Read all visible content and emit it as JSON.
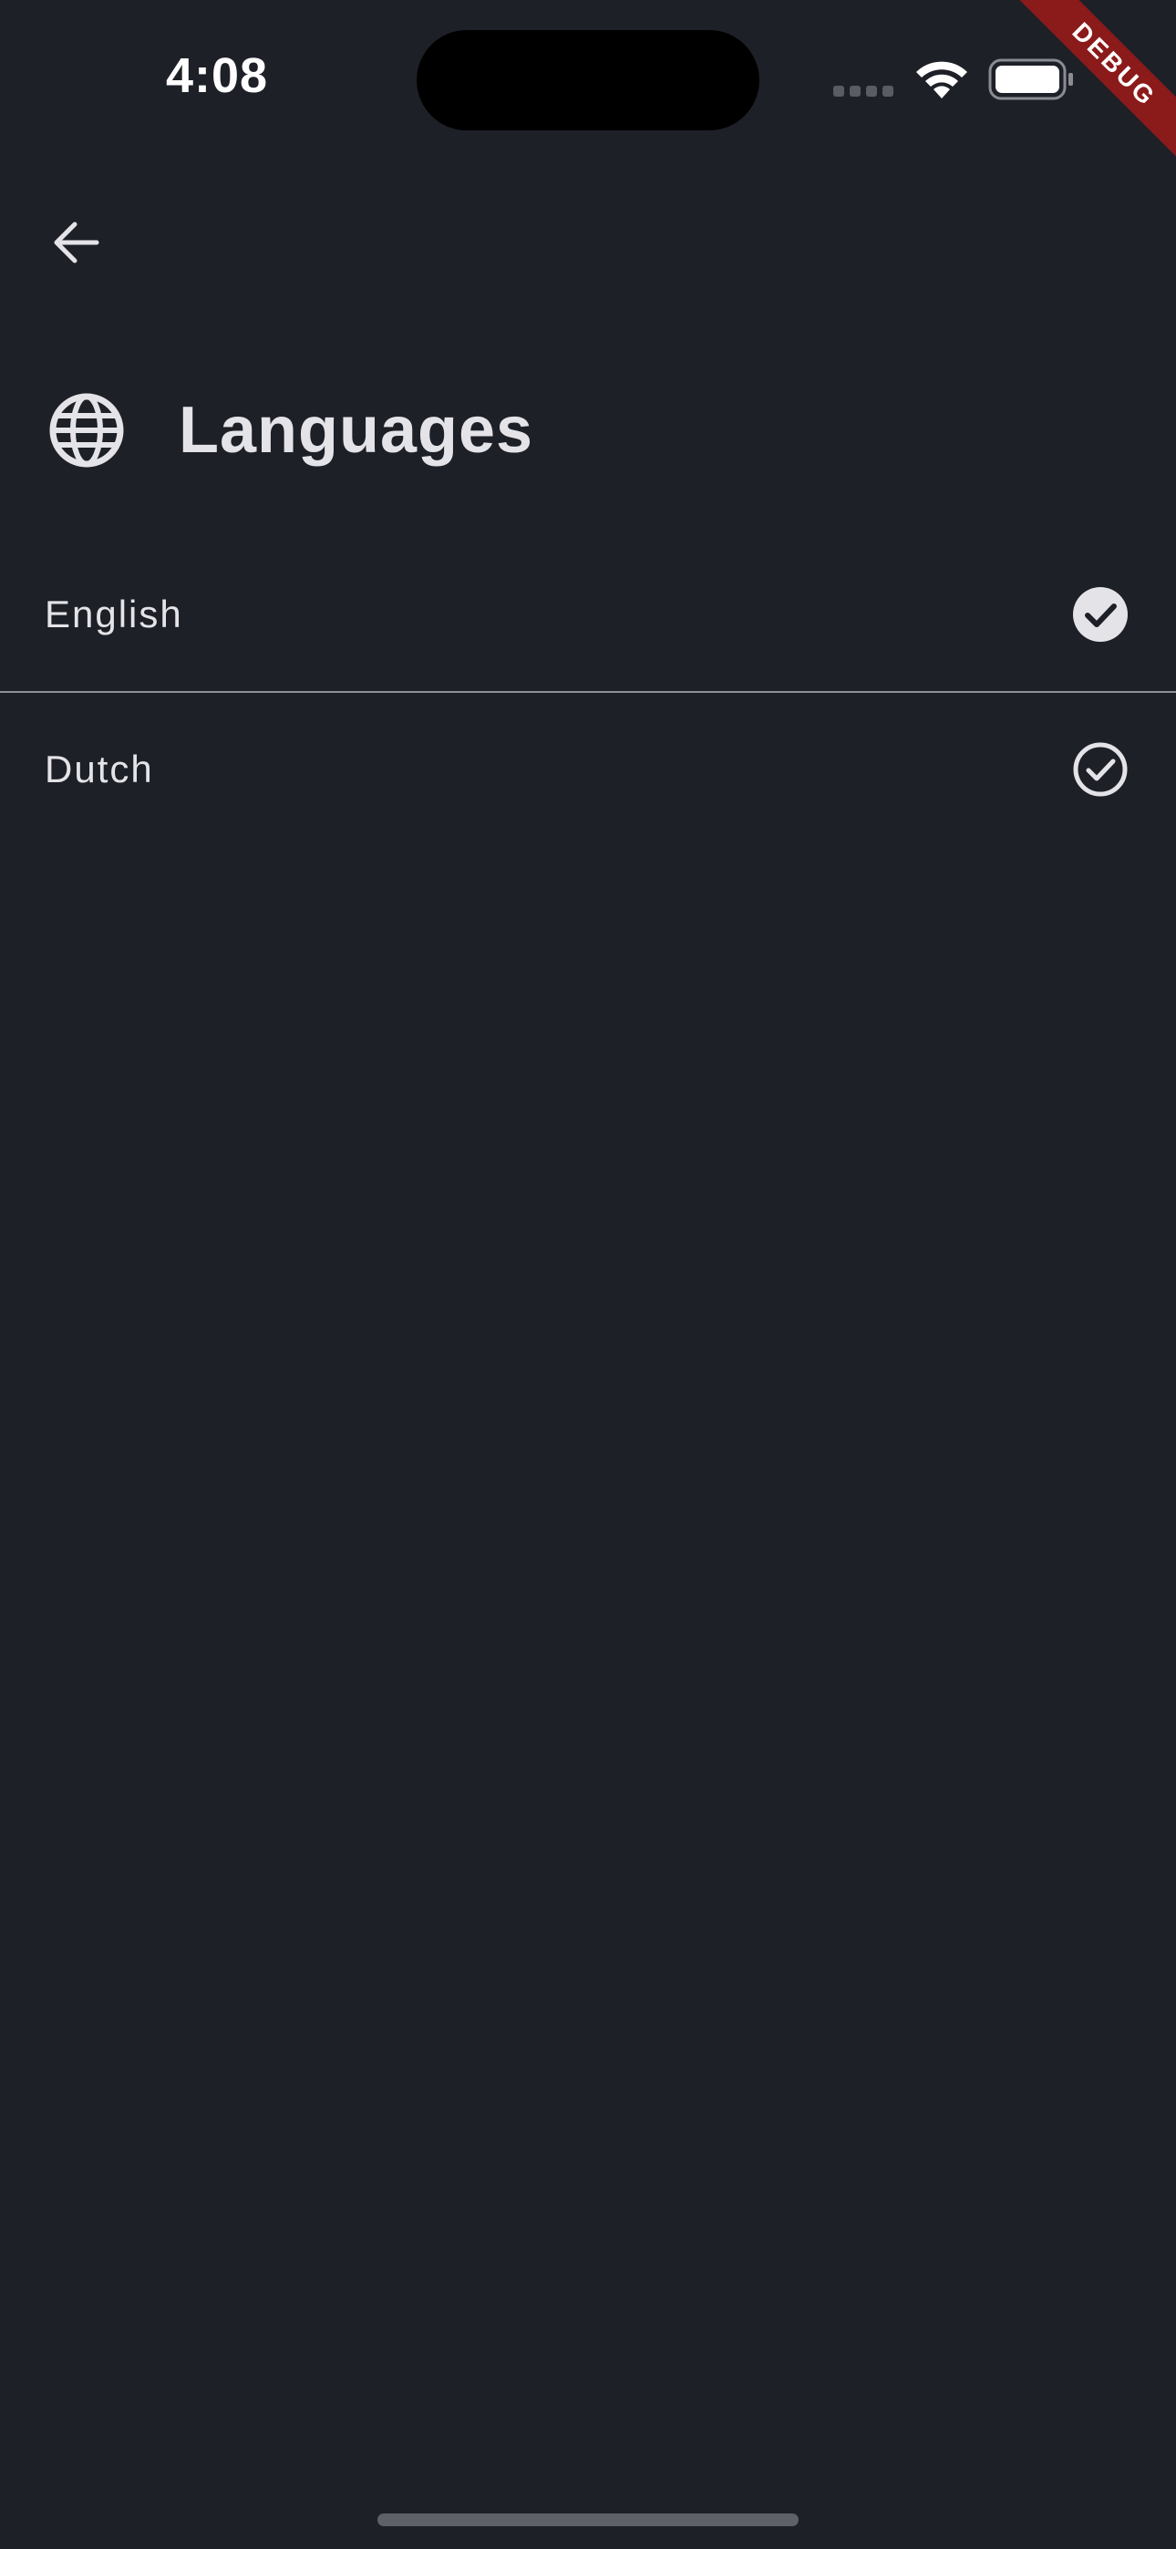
{
  "status_bar": {
    "time": "4:08"
  },
  "debug_banner": {
    "label": "DEBUG"
  },
  "nav": {
    "back_icon": "arrow-back-icon"
  },
  "header": {
    "icon": "globe-icon",
    "title": "Languages"
  },
  "languages": [
    {
      "label": "English",
      "selected": true,
      "icon": "check-circle-filled-icon"
    },
    {
      "label": "Dutch",
      "selected": false,
      "icon": "check-circle-outline-icon"
    }
  ],
  "colors": {
    "background": "#1e2028",
    "text": "#e4e4e8",
    "divider": "#8e9097",
    "debug_ribbon": "#8b1a1a"
  }
}
